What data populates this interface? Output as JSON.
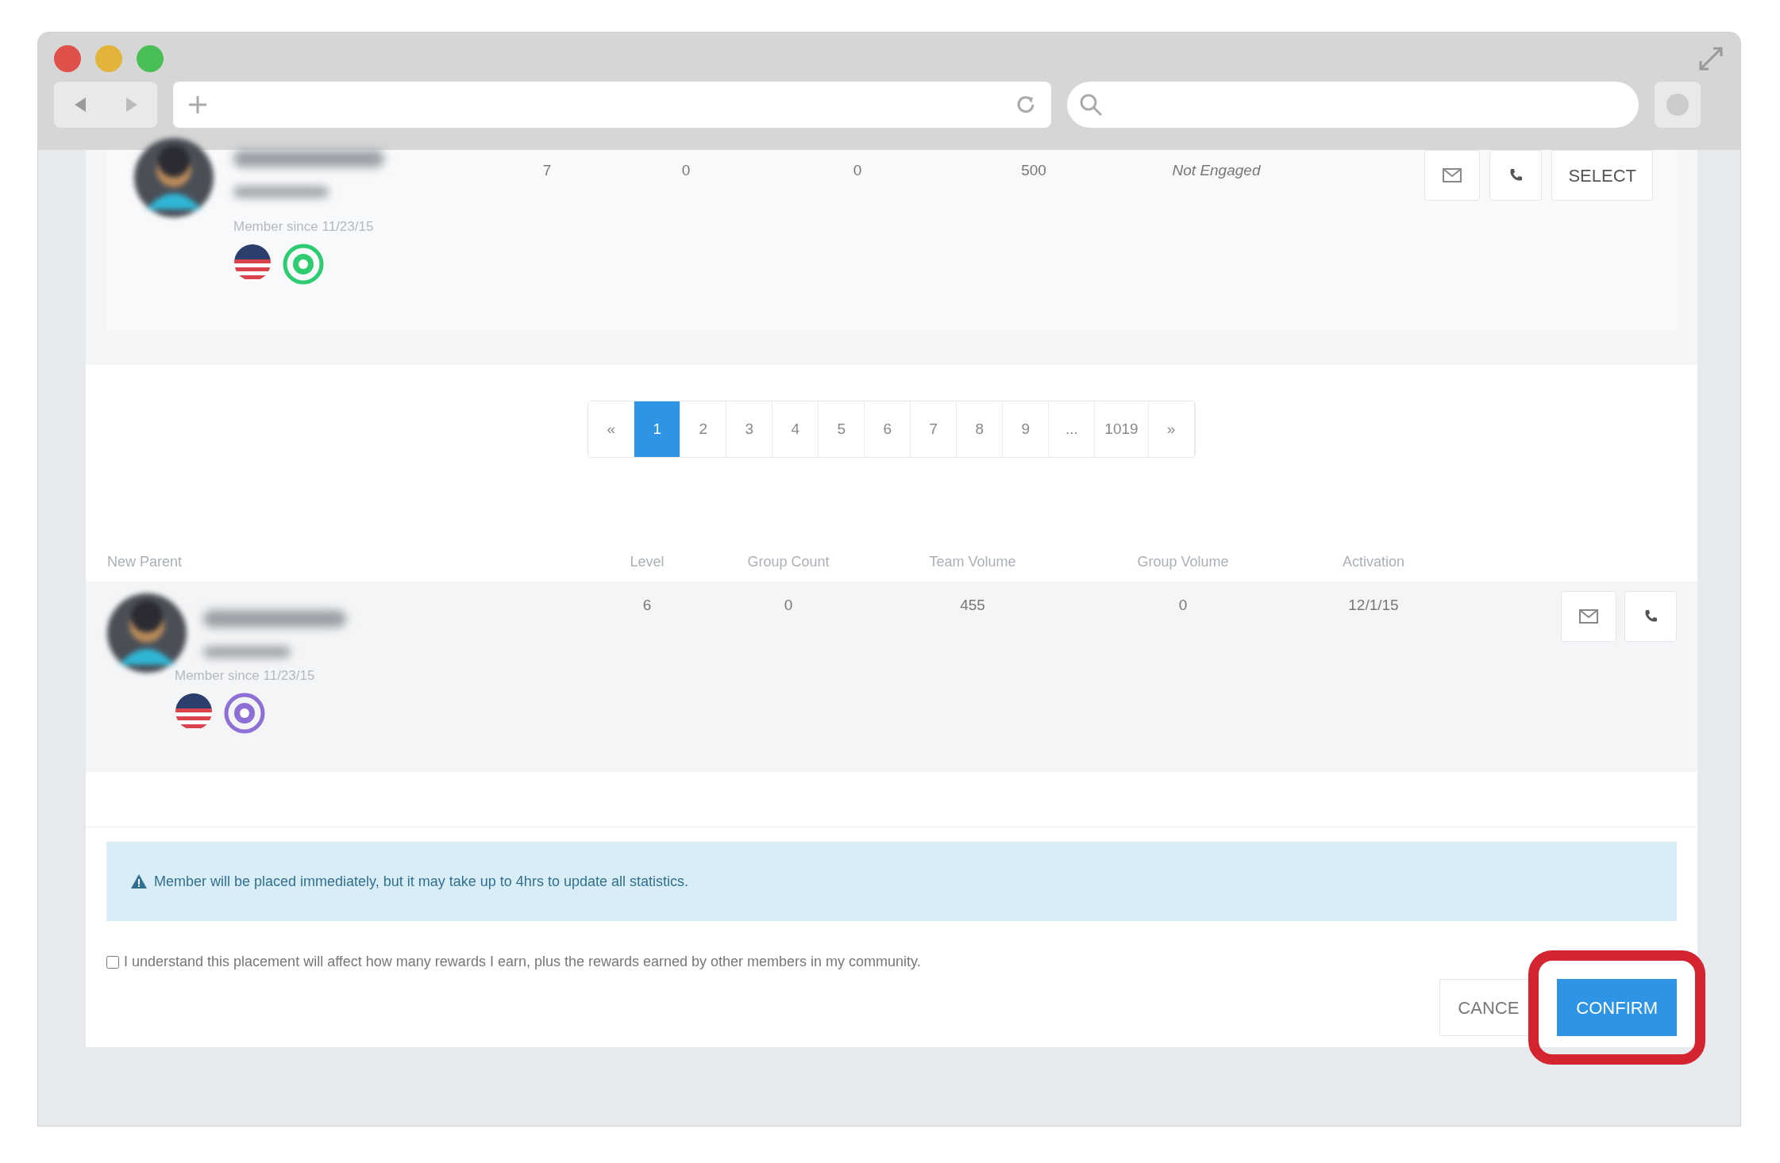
{
  "top_member": {
    "member_since": "Member since 11/23/15",
    "values": [
      "7",
      "0",
      "0",
      "500"
    ],
    "status": "Not Engaged",
    "select_label": "SELECT"
  },
  "pagination": [
    {
      "label": "«",
      "selected": false
    },
    {
      "label": "1",
      "selected": true
    },
    {
      "label": "2",
      "selected": false
    },
    {
      "label": "3",
      "selected": false
    },
    {
      "label": "4",
      "selected": false
    },
    {
      "label": "5",
      "selected": false
    },
    {
      "label": "6",
      "selected": false
    },
    {
      "label": "7",
      "selected": false
    },
    {
      "label": "8",
      "selected": false
    },
    {
      "label": "9",
      "selected": false
    },
    {
      "label": "...",
      "selected": false
    },
    {
      "label": "1019",
      "selected": false
    },
    {
      "label": "»",
      "selected": false
    }
  ],
  "new_parent": {
    "columns": [
      "New Parent",
      "Level",
      "Group Count",
      "Team Volume",
      "Group Volume",
      "Activation"
    ],
    "member_since": "Member since 11/23/15",
    "values": [
      "6",
      "0",
      "455",
      "0",
      "12/1/15"
    ]
  },
  "alert": "Member will be placed immediately, but it may take up to 4hrs to update all statistics.",
  "agreement": {
    "label": "I understand this placement will affect how many rewards I earn, plus the rewards earned by other members in my community.",
    "checked": false
  },
  "buttons": {
    "cancel": "CANCE",
    "confirm": "CONFIRM"
  }
}
